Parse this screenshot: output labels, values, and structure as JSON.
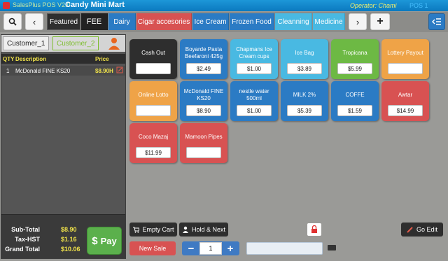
{
  "titlebar": {
    "app_name": "SalesPlus POS V2.0",
    "store_name": "Candy Mini Mart",
    "operator": "Operator: Chami",
    "pos_label": "POS 1"
  },
  "toolbar": {
    "tabs": [
      {
        "label": "Featured",
        "color": "#2f2f2f"
      },
      {
        "label": "FEE",
        "color": "#222222"
      },
      {
        "label": "Dairy",
        "color": "#2b7bc4"
      },
      {
        "label": "Cigar accesories",
        "color": "#d85252"
      },
      {
        "label": "Ice Cream",
        "color": "#2b7bc4"
      },
      {
        "label": "Frozen Food",
        "color": "#2b7bc4"
      },
      {
        "label": "Cleanning",
        "color": "#49b9e2"
      },
      {
        "label": "Medicine",
        "color": "#49b9e2"
      }
    ]
  },
  "customers": {
    "tab1": "Customer_1",
    "tab2": "Customer_2"
  },
  "order_grid": {
    "headers": {
      "qty": "QTY",
      "description": "Description",
      "price": "Price"
    },
    "items": [
      {
        "qty": "1",
        "description": "McDonald FINE KS20",
        "price": "$8.90H"
      }
    ]
  },
  "totals": {
    "subtotal_label": "Sub-Total",
    "subtotal": "$8.90",
    "tax_label": "Tax-HST",
    "tax": "$1.16",
    "grand_label": "Grand Total",
    "grand": "$10.06",
    "pay_label": "Pay"
  },
  "products": [
    {
      "name": "Cash Out",
      "price": ""
    },
    {
      "name": "Boyarde Pasta Beefaroni 425g",
      "price": "$2.49"
    },
    {
      "name": "Chapmans Ice Cream cups",
      "price": "$1.00"
    },
    {
      "name": "Ice Bag",
      "price": "$3.89"
    },
    {
      "name": "Tropicana",
      "price": "$5.99"
    },
    {
      "name": "Lottery Payout",
      "price": ""
    },
    {
      "name": "Online Lotto",
      "price": ""
    },
    {
      "name": "McDonald FINE KS20",
      "price": "$8.90"
    },
    {
      "name": "nestle water 500ml",
      "price": "$1.00"
    },
    {
      "name": "MILK 2%",
      "price": "$5.39"
    },
    {
      "name": "COFFE",
      "price": "$1.59"
    },
    {
      "name": "Awtar",
      "price": "$14.99"
    },
    {
      "name": "Coco Mazaj",
      "price": "$11.99"
    },
    {
      "name": "Mamoon Pipes",
      "price": ""
    }
  ],
  "actions": {
    "empty_cart": "Empty Cart",
    "hold_next": "Hold & Next",
    "go_edit": "Go Edit",
    "new_sale": "New Sale",
    "quantity": "1",
    "minus": "−",
    "plus": "+"
  },
  "colors": {
    "accent_blue": "#2b7bc4",
    "accent_red": "#d85252",
    "accent_green": "#6db944",
    "accent_orange": "#efa347",
    "accent_cyan": "#49b9e2",
    "highlight_yellow": "#f0e24a"
  }
}
